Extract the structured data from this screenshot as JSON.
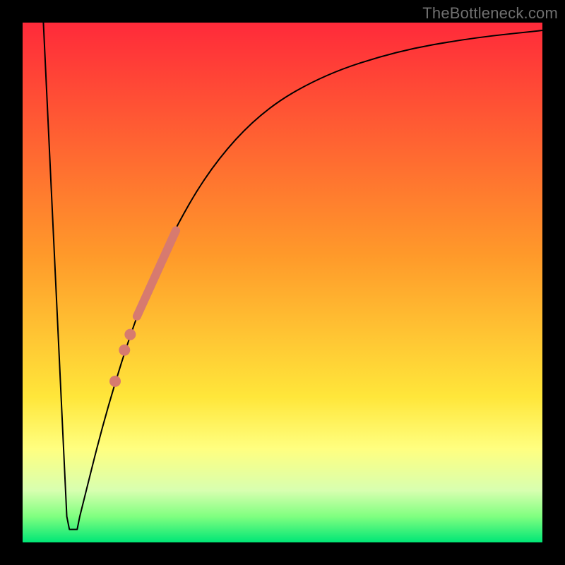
{
  "attribution": "TheBottleneck.com",
  "chart_data": {
    "type": "line",
    "title": "",
    "xlabel": "",
    "ylabel": "",
    "xlim": [
      0,
      100
    ],
    "ylim": [
      0,
      100
    ],
    "grid": false,
    "legend": false,
    "gradient_stops": [
      {
        "pct": 0,
        "color": "#ff2a3a"
      },
      {
        "pct": 45,
        "color": "#ff9a2a"
      },
      {
        "pct": 72,
        "color": "#ffe63a"
      },
      {
        "pct": 82,
        "color": "#ffff80"
      },
      {
        "pct": 90,
        "color": "#d8ffb0"
      },
      {
        "pct": 95,
        "color": "#80ff80"
      },
      {
        "pct": 100,
        "color": "#00e676"
      }
    ],
    "series": [
      {
        "name": "bottleneck-curve",
        "type": "line",
        "color": "#000000",
        "stroke_width": 2,
        "tension": 0,
        "points": [
          {
            "x": 4.0,
            "y": 100.0
          },
          {
            "x": 8.5,
            "y": 5.0
          },
          {
            "x": 9.0,
            "y": 2.5
          },
          {
            "x": 10.5,
            "y": 2.5
          },
          {
            "x": 11.0,
            "y": 5.0
          },
          {
            "x": 16.0,
            "y": 25.0
          },
          {
            "x": 22.0,
            "y": 44.0
          },
          {
            "x": 28.0,
            "y": 58.0
          },
          {
            "x": 36.0,
            "y": 72.0
          },
          {
            "x": 46.0,
            "y": 83.0
          },
          {
            "x": 58.0,
            "y": 90.0
          },
          {
            "x": 72.0,
            "y": 94.5
          },
          {
            "x": 86.0,
            "y": 97.0
          },
          {
            "x": 100.0,
            "y": 98.5
          }
        ]
      },
      {
        "name": "highlight-band",
        "type": "line-segment",
        "color": "#d77a6f",
        "stroke_width": 12,
        "linecap": "round",
        "points": [
          {
            "x": 22.0,
            "y": 43.5
          },
          {
            "x": 29.5,
            "y": 60.0
          }
        ]
      },
      {
        "name": "highlight-dots",
        "type": "scatter",
        "color": "#d77a6f",
        "radius": 8,
        "points": [
          {
            "x": 20.7,
            "y": 40.0
          },
          {
            "x": 19.6,
            "y": 37.0
          },
          {
            "x": 17.8,
            "y": 31.0
          }
        ]
      }
    ]
  }
}
